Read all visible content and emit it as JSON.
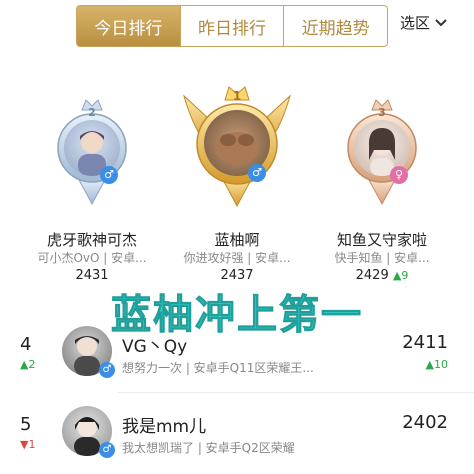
{
  "tabs": [
    {
      "label": "今日排行",
      "active": true
    },
    {
      "label": "昨日排行",
      "active": false
    },
    {
      "label": "近期趋势",
      "active": false
    }
  ],
  "region": {
    "label": "选区",
    "icon": "chevron-down-icon"
  },
  "podium": [
    {
      "rank": "2",
      "name": "虎牙歌神可杰",
      "sub": "可小杰OvO | 安卓...",
      "score": "2431",
      "delta": "",
      "gender": "male"
    },
    {
      "rank": "1",
      "name": "蓝柚啊",
      "sub": "你进攻好强 | 安卓...",
      "score": "2437",
      "delta": "",
      "gender": "male"
    },
    {
      "rank": "3",
      "name": "知鱼又守家啦",
      "sub": "快手知鱼 | 安卓...",
      "score": "2429",
      "delta": "9",
      "gender": "female"
    }
  ],
  "banner": "蓝柚冲上第一",
  "list": [
    {
      "rank": "4",
      "rank_delta": "2",
      "rank_dir": "up",
      "name": "VG丶Qy",
      "sub": "想努力一次 | 安卓手Q11区荣耀王...",
      "score": "2411",
      "score_delta": "10",
      "score_dir": "up",
      "gender": "male"
    },
    {
      "rank": "5",
      "rank_delta": "1",
      "rank_dir": "down",
      "name": "我是mm儿",
      "sub": "我太想凯瑞了 | 安卓手Q2区荣耀",
      "score": "2402",
      "score_delta": "",
      "score_dir": "",
      "gender": "male"
    }
  ],
  "colors": {
    "gold": "#c9a45c",
    "banner": "#37c9c4",
    "up": "#2aa84a",
    "down": "#d9473b"
  }
}
